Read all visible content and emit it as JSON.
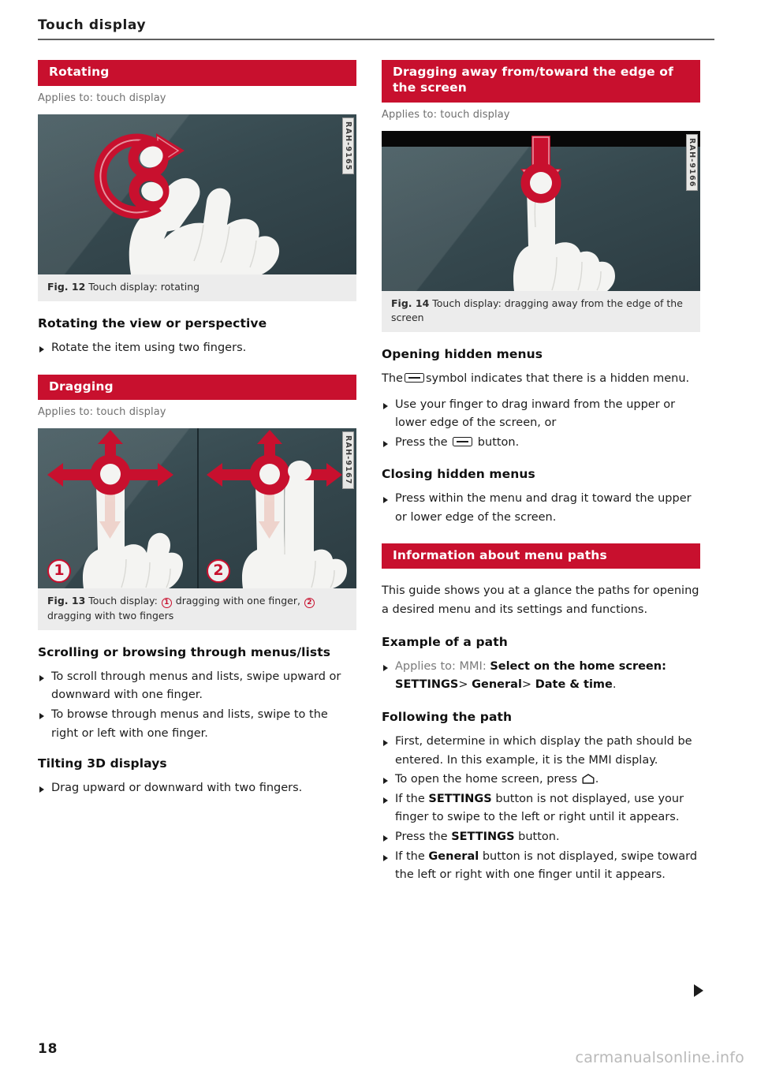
{
  "running_head": {
    "title": "Touch display"
  },
  "footer": {
    "page_number": "18",
    "watermark": "carmanualsonline.info"
  },
  "left_column": {
    "section_rotating": {
      "heading": "Rotating",
      "applies_to": "Applies to: touch display",
      "figure": {
        "code": "RAH-9165",
        "caption_label": "Fig. 12",
        "caption_text": "Touch display: rotating"
      },
      "subheading": "Rotating the view or perspective",
      "bullets": [
        "Rotate the item using two fingers."
      ]
    },
    "section_dragging": {
      "heading": "Dragging",
      "applies_to": "Applies to: touch display",
      "figure": {
        "code": "RAH-9167",
        "caption_label": "Fig. 13",
        "caption_prefix": "Touch display:",
        "caption_item1": "dragging with one finger,",
        "caption_item2": "dragging with two fingers",
        "badge1": "1",
        "badge2": "2"
      },
      "subheading_scrolling": "Scrolling or browsing through menus/lists",
      "bullets_scrolling": [
        "To scroll through menus and lists, swipe upward or downward with one finger.",
        "To browse through menus and lists, swipe to the right or left with one finger."
      ],
      "subheading_tilting": "Tilting 3D displays",
      "bullets_tilting": [
        "Drag upward or downward with two fingers."
      ]
    }
  },
  "right_column": {
    "section_dragging_edge": {
      "heading": "Dragging away from/toward the edge of the screen",
      "applies_to": "Applies to: touch display",
      "figure": {
        "code": "RAH-9166",
        "caption_label": "Fig. 14",
        "caption_text": "Touch display: dragging away from the edge of the screen"
      },
      "subheading_opening": "Opening hidden menus",
      "para_opening_pre": "The",
      "para_opening_post": "symbol indicates that there is a hidden menu.",
      "bullets_opening": [
        "Use your finger to drag inward from the upper or lower edge of the screen, or"
      ],
      "bullet_press_pre": "Press the",
      "bullet_press_post": "button.",
      "subheading_closing": "Closing hidden menus",
      "bullets_closing": [
        "Press within the menu and drag it toward the upper or lower edge of the screen."
      ]
    },
    "section_menu_paths": {
      "heading": "Information about menu paths",
      "intro": "This guide shows you at a glance the paths for opening a desired menu and its settings and functions.",
      "subheading_example": "Example of a path",
      "example_applies_to": "Applies to: MMI:",
      "example_select": "Select on the home screen:",
      "example_path_1": "SETTINGS",
      "example_sep_1": ">",
      "example_path_2": "General",
      "example_sep_2": ">",
      "example_path_3": "Date & time",
      "example_period": ".",
      "subheading_following": "Following the path",
      "bullet_first": "First, determine in which display the path should be entered. In this example, it is the MMI display.",
      "bullet_home_pre": "To open the home screen, press",
      "bullet_home_post": ".",
      "bullet_settings_pre": "If the",
      "bullet_settings_bold": "SETTINGS",
      "bullet_settings_post": "button is not displayed, use your finger to swipe to the left or right until it appears.",
      "bullet_press_pre": "Press the",
      "bullet_press_bold": "SETTINGS",
      "bullet_press_post": "button.",
      "bullet_general_pre": "If the",
      "bullet_general_bold": "General",
      "bullet_general_post": "button is not displayed, swipe toward the left or right with one finger until it appears."
    }
  },
  "icons": {
    "hidden_menu": "hidden-menu-bar-icon",
    "home": "home-icon",
    "continuation": "continuation-arrow-icon"
  },
  "colors": {
    "accent_red": "#c8102e",
    "caption_bg": "#ececec",
    "figure_bg": "#33484e"
  }
}
